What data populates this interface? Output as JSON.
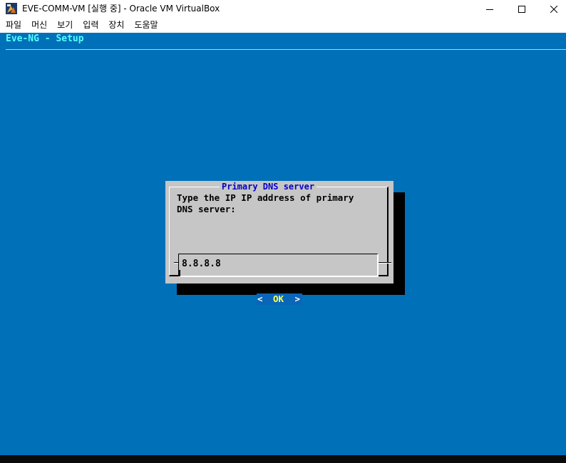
{
  "window": {
    "title": "EVE-COMM-VM [실행 중] - Oracle VM VirtualBox",
    "icons": [
      "virtualbox-icon",
      "minimize-icon",
      "maximize-icon",
      "close-icon"
    ]
  },
  "menu": {
    "items": [
      "파일",
      "머신",
      "보기",
      "입력",
      "장치",
      "도움말"
    ]
  },
  "console": {
    "backtitle": "Eve-NG - Setup",
    "colors": {
      "background": "#0070b8",
      "backtitle": "#55ffff",
      "dialog": "#c6c6c6",
      "dialog_title": "#0000c8",
      "button_bg": "#0a66b8",
      "button_label": "#ffff55"
    }
  },
  "dialog": {
    "title": "Primary DNS server",
    "prompt": "Type the IP IP address of primary\nDNS server:",
    "input_value": "8.8.8.8",
    "button": {
      "left": "<",
      "label": "OK",
      "right": ">"
    }
  }
}
